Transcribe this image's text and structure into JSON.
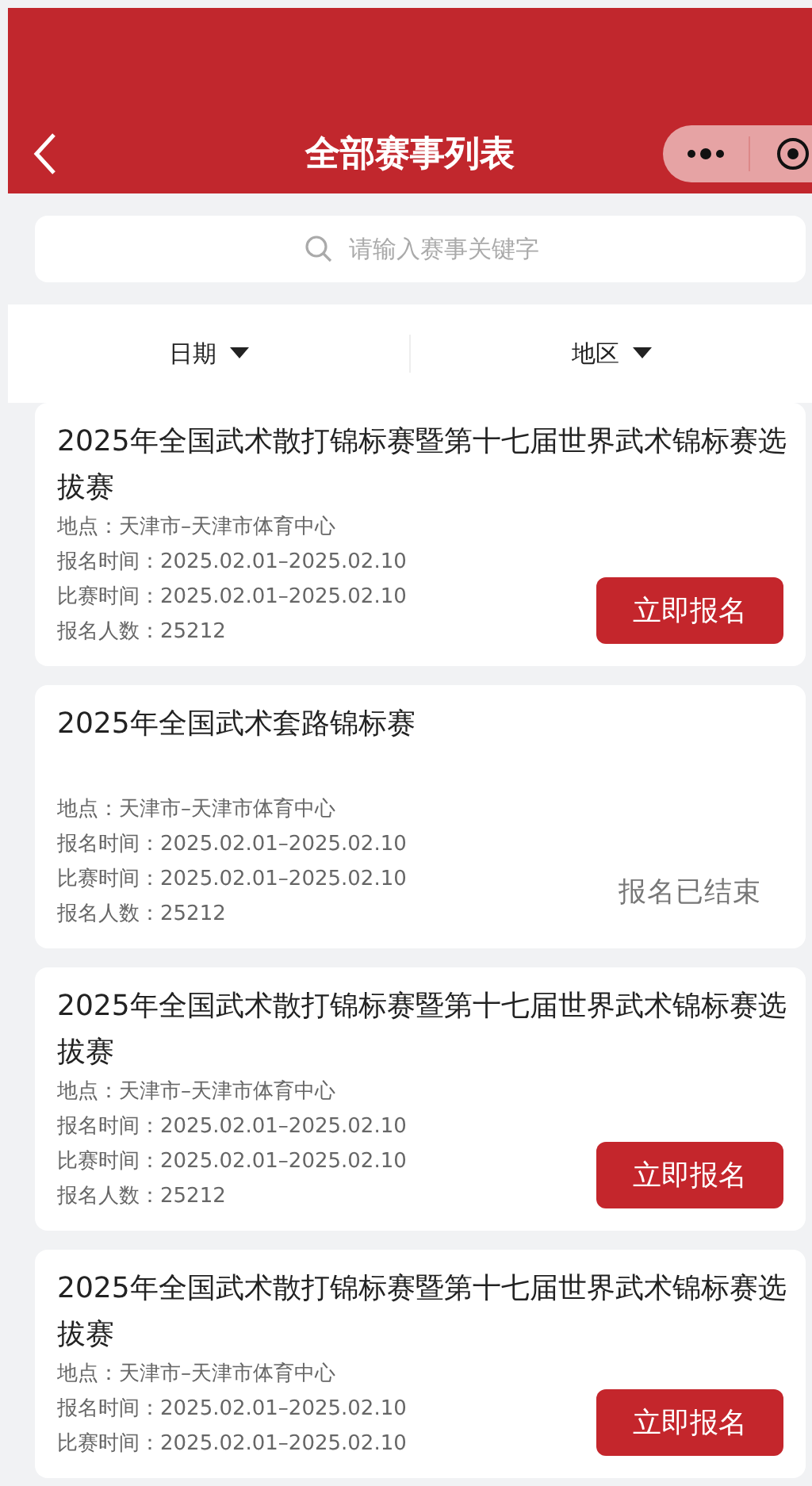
{
  "header": {
    "title": "全部赛事列表"
  },
  "search": {
    "placeholder": "请输入赛事关键字"
  },
  "filters": [
    {
      "label": "日期"
    },
    {
      "label": "地区"
    }
  ],
  "events": [
    {
      "title": "2025年全国武术散打锦标赛暨第十七届世界武术锦标赛选拔赛",
      "info": [
        "地点：天津市–天津市体育中心",
        "报名时间：2025.02.01–2025.02.10",
        "比赛时间：2025.02.01–2025.02.10",
        "报名人数：25212"
      ],
      "action": {
        "kind": "button",
        "label": "立即报名"
      }
    },
    {
      "title": "2025年全国武术套路锦标赛",
      "info": [
        "地点：天津市–天津市体育中心",
        "报名时间：2025.02.01–2025.02.10",
        "比赛时间：2025.02.01–2025.02.10",
        "报名人数：25212"
      ],
      "action": {
        "kind": "ended",
        "label": "报名已结束"
      }
    },
    {
      "title": "2025年全国武术散打锦标赛暨第十七届世界武术锦标赛选拔赛",
      "info": [
        "地点：天津市–天津市体育中心",
        "报名时间：2025.02.01–2025.02.10",
        "比赛时间：2025.02.01–2025.02.10",
        "报名人数：25212"
      ],
      "action": {
        "kind": "button",
        "label": "立即报名"
      }
    },
    {
      "title": "2025年全国武术散打锦标赛暨第十七届世界武术锦标赛选拔赛",
      "info": [
        "地点：天津市–天津市体育中心",
        "报名时间：2025.02.01–2025.02.10",
        "比赛时间：2025.02.01–2025.02.10"
      ],
      "action": {
        "kind": "button",
        "label": "立即报名"
      }
    }
  ]
}
